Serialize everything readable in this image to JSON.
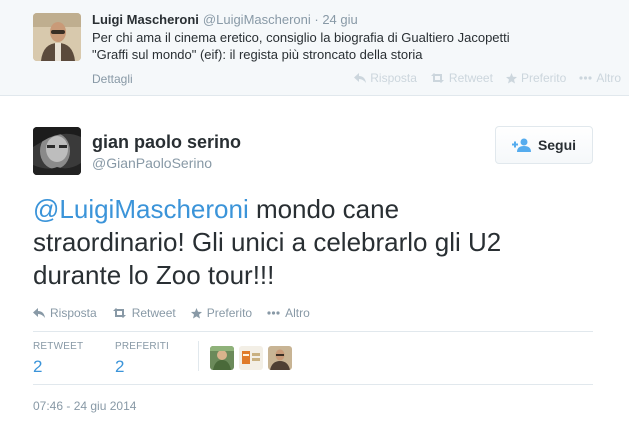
{
  "parent_tweet": {
    "author_name": "Luigi Mascheroni",
    "author_handle": "@LuigiMascheroni",
    "time": "· 24 giu",
    "text_lines": [
      "Per chi ama il cinema eretico, consiglio la biografia di Gualtiero Jacopetti",
      "\"Graffi sul mondo\" (eif): il regista più stroncato della storia"
    ],
    "details_label": "Dettagli",
    "actions": {
      "reply": "Risposta",
      "retweet": "Retweet",
      "favorite": "Preferito",
      "more": "Altro"
    }
  },
  "main_tweet": {
    "author_name": "gian paolo serino",
    "author_handle": "@GianPaoloSerino",
    "follow_label": "Segui",
    "mention": "@LuigiMascheroni",
    "text_lines": [
      " mondo cane",
      "straordinario! Gli unici a celebrarlo gli U2",
      "durante lo Zoo tour!!!"
    ],
    "actions": {
      "reply": "Risposta",
      "retweet": "Retweet",
      "favorite": "Preferito",
      "more": "Altro"
    },
    "stats": {
      "retweet_label": "RETWEET",
      "retweet_count": "2",
      "favorites_label": "PREFERITI",
      "favorites_count": "2"
    },
    "timestamp": "07:46 - 24 giu 2014"
  },
  "colors": {
    "link": "#3b94d9",
    "muted": "#8899a6",
    "text": "#292f33",
    "parent_bg": "#f5f8fa",
    "border": "#e1e8ed"
  }
}
